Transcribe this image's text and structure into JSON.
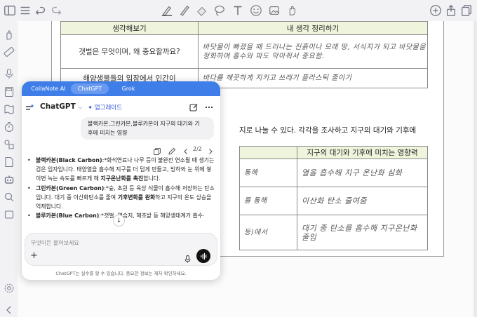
{
  "toolbar": {
    "icons": [
      "sidebar-toggle-icon",
      "list-icon",
      "undo-icon",
      "redo-icon",
      "pen-icon",
      "pencil-icon",
      "eraser-icon",
      "lasso-icon",
      "text-icon",
      "sticker-icon",
      "image-icon",
      "hand-icon",
      "add-page-icon",
      "share-icon",
      "duplicate-icon"
    ]
  },
  "sidebar": {
    "icons": [
      "hand-tool-icon",
      "ruler-icon",
      "microphone-icon",
      "calculator-icon",
      "map-icon",
      "timer-icon",
      "shapes-icon",
      "document-icon",
      "ai-robot-icon",
      "search-icon",
      "storage-icon",
      "settings-icon",
      "collapse-icon"
    ]
  },
  "document": {
    "table1": {
      "headers": [
        "생각해보기",
        "내 생각 정리하기"
      ],
      "rows": [
        {
          "question": "갯벌은 무엇이며, 왜 중요할까요?",
          "answer": "바닷물이 빠졌을 때 드러나는 진흙이나 모래 땅, 서식지가 되고 바닷물을 정화하며 홍수와 파도 막아줘서 중요함."
        },
        {
          "question": "해양생물들의 입장에서 인간이",
          "answer": "바다를 깨끗하게 지키고 쓰레기 플라스틱 줄이기"
        }
      ]
    },
    "line_text": "지로 나눌 수 있다. 각각을 조사하고 지구의 대기와 기후에",
    "table2": {
      "header": "지구의 대기와 기후에 미치는 영향력",
      "rows": [
        {
          "left": "통해",
          "right": "열을 흡수해 지구 온난화 심화"
        },
        {
          "left": "를 통해",
          "right": "이산화 탄소 줄여줌"
        },
        {
          "left": "등)에서",
          "right": "대기 중 탄소를 흡수해 지구온난화 줄임"
        }
      ]
    }
  },
  "panel": {
    "tabs": [
      "CollaNote AI",
      "ChatGPT",
      "Grok"
    ],
    "active_tab": "ChatGPT",
    "model_label": "ChatGPT",
    "upgrade_label": "업그레이드",
    "user_message_line1": "블랙카본,그린카본,블루카본이 지구의 대기와 기",
    "user_message_line2": "후에 미치는 영향",
    "pager": "2/2",
    "response": [
      {
        "term": "블랙카본(Black Carbon)",
        "text1": ":*화석연료나 나무 등이 불완전 연소될 때 생기는 검은 입자입니다. 태양열을 흡수해 지구를 더 덥게 만들고, 빙하와 눈 위에 쌓이면 녹는 속도를 빠르게 해 ",
        "bold2": "지구온난화를 촉진",
        "text2": "합니다."
      },
      {
        "term": "그린카본(Green Carbon)",
        "text1": ":*숲, 초원 등 육상 식물이 흡수해 저장하는 탄소입니다. 대기 중 이산화탄소를 줄여 ",
        "bold2": "기후변화를 완화",
        "text2": "하고 지구의 온도 상승을 억제합니다."
      },
      {
        "term": "블루카본(Blue Carbon)",
        "text1": ":*갯벌, 염습지, 해초밭 등 해양생태계가 흡수·",
        "bold2": "",
        "text2": ""
      }
    ],
    "input_placeholder": "무엇이든 물어보세요",
    "disclaimer": "ChatGPT는 실수를 할 수 있습니다. 중요한 정보는 재차 확인하세요."
  },
  "colors": {
    "tab_bar": "#3f7ee8",
    "upgrade": "#2f55d4",
    "table_header": "#eef5dc"
  }
}
